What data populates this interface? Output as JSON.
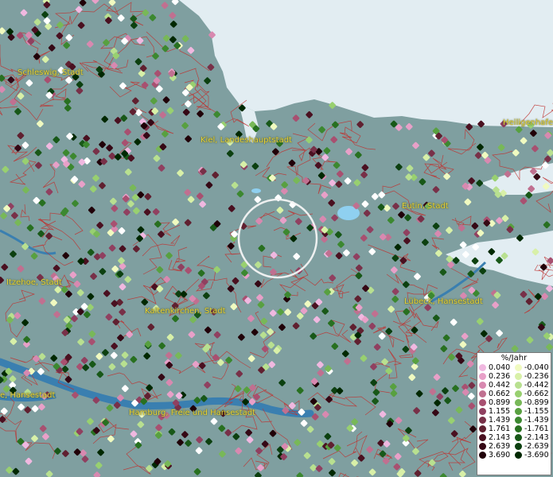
{
  "map": {
    "colors": {
      "land": "#7f9fa0",
      "water": "#e2edf2",
      "river": "#3a7fb0",
      "border": "#c0302e",
      "label": "#e8d23a"
    },
    "cities": [
      {
        "name": "Schleswig, Stadt"
      },
      {
        "name": "Kiel, Landeshauptstadt"
      },
      {
        "name": "Heiligenhafen"
      },
      {
        "name": "Eutin, Stadt"
      },
      {
        "name": "Itzehoe, Stadt"
      },
      {
        "name": "Kaltenkirchen, Stadt"
      },
      {
        "name": "Lübeck, Hansestadt"
      },
      {
        "name": "e, Hansestadt"
      },
      {
        "name": "Hamburg, Freie und Hansestadt"
      }
    ]
  },
  "legend": {
    "title": "%/Jahr",
    "rise": [
      {
        "label": "0.040",
        "color": "#f0b8e0"
      },
      {
        "label": "0.236",
        "color": "#e8a0c8"
      },
      {
        "label": "0.442",
        "color": "#d889b0"
      },
      {
        "label": "0.662",
        "color": "#c07090"
      },
      {
        "label": "0.899",
        "color": "#a85070"
      },
      {
        "label": "1.155",
        "color": "#904060"
      },
      {
        "label": "1.439",
        "color": "#783048"
      },
      {
        "label": "1.761",
        "color": "#602030"
      },
      {
        "label": "2.143",
        "color": "#4a1020"
      },
      {
        "label": "2.639",
        "color": "#350815"
      },
      {
        "label": "3.690",
        "color": "#200008"
      }
    ],
    "fall": [
      {
        "label": "-0.040",
        "color": "#f0fac0"
      },
      {
        "label": "-0.236",
        "color": "#d8f0a8"
      },
      {
        "label": "-0.442",
        "color": "#b8e090"
      },
      {
        "label": "-0.662",
        "color": "#98d070"
      },
      {
        "label": "-0.899",
        "color": "#78b858"
      },
      {
        "label": "-1.155",
        "color": "#58a040"
      },
      {
        "label": "-1.439",
        "color": "#3c8830"
      },
      {
        "label": "-1.761",
        "color": "#287020"
      },
      {
        "label": "-2.143",
        "color": "#185818"
      },
      {
        "label": "-2.639",
        "color": "#0c4010"
      },
      {
        "label": "-3.690",
        "color": "#002800"
      }
    ]
  }
}
